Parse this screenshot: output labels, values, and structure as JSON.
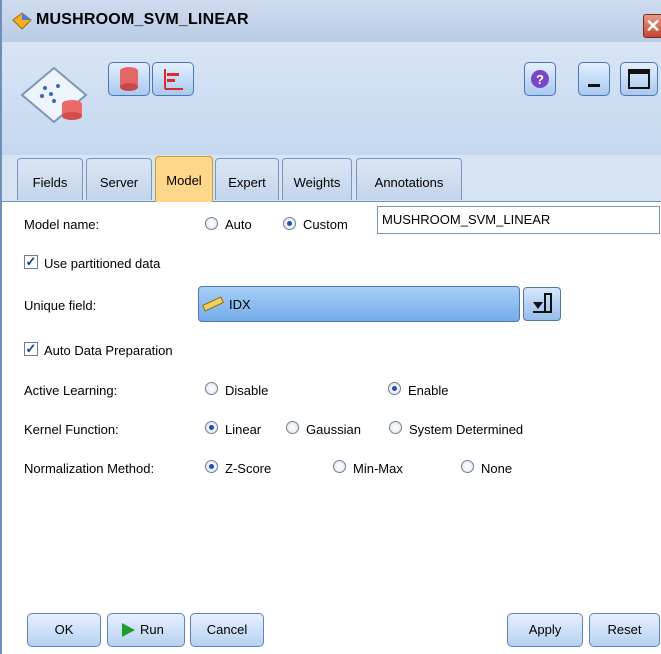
{
  "window": {
    "title": "MUSHROOM_SVM_LINEAR",
    "close_symbol": "✕"
  },
  "tabs": [
    {
      "label": "Fields"
    },
    {
      "label": "Server"
    },
    {
      "label": "Model"
    },
    {
      "label": "Expert"
    },
    {
      "label": "Weights"
    },
    {
      "label": "Annotations"
    }
  ],
  "model_name": {
    "label": "Model name:",
    "auto": "Auto",
    "custom": "Custom",
    "value": "MUSHROOM_SVM_LINEAR",
    "selected": "Custom"
  },
  "use_partitioned_data": {
    "label": "Use partitioned data",
    "checked": true
  },
  "unique_field": {
    "label": "Unique field:",
    "value": "IDX"
  },
  "auto_data_preparation": {
    "label": "Auto Data Preparation",
    "checked": true
  },
  "active_learning": {
    "label": "Active Learning:",
    "options": [
      "Disable",
      "Enable"
    ],
    "selected": "Enable"
  },
  "kernel_function": {
    "label": "Kernel Function:",
    "options": [
      "Linear",
      "Gaussian",
      "System Determined"
    ],
    "selected": "Linear"
  },
  "normalization_method": {
    "label": "Normalization Method:",
    "options": [
      "Z-Score",
      "Min-Max",
      "None"
    ],
    "selected": "Z-Score"
  },
  "buttons": {
    "ok": "OK",
    "run": "Run",
    "cancel": "Cancel",
    "apply": "Apply",
    "reset": "Reset"
  },
  "icons": {
    "app": "diamond-icon",
    "model": "svm-model-icon",
    "data": "database-icon",
    "chart": "bar-chart-icon",
    "help": "help-icon",
    "minimize": "minimize-icon",
    "maximize": "maximize-icon",
    "ruler": "ruler-icon",
    "select": "field-picker-icon",
    "run": "play-icon"
  },
  "colors": {
    "tab_active": "#ffd78a",
    "radio_selected": "#1f4fb3",
    "run_green": "#1f9b2d",
    "close_red": "#c6452f"
  }
}
